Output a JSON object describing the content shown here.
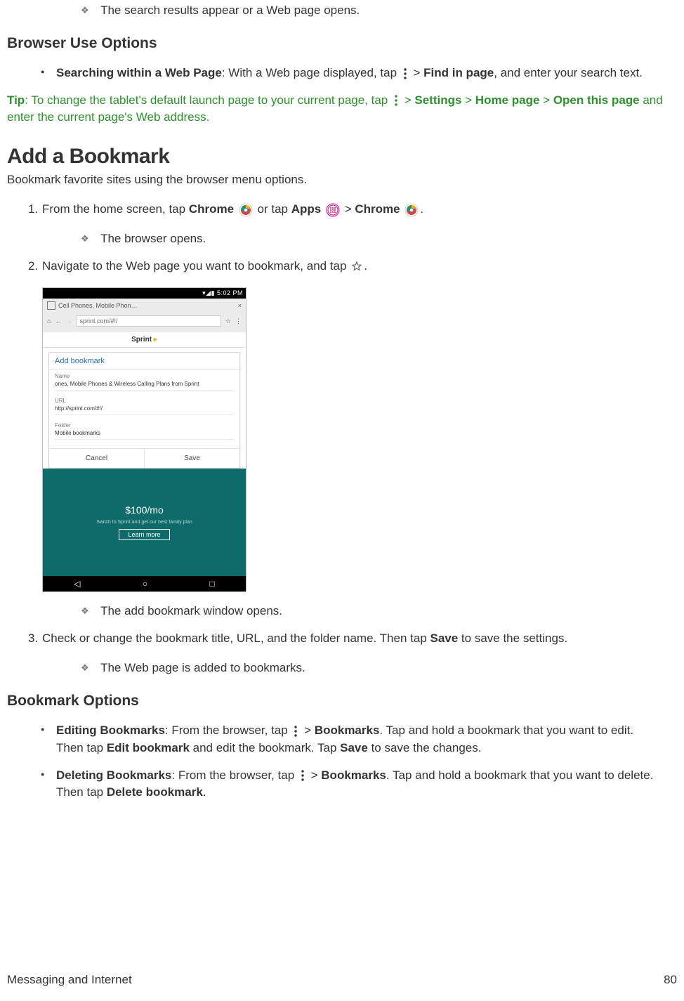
{
  "top_result": "The search results appear or a Web page opens.",
  "browser_use": {
    "heading": "Browser Use Options",
    "item_label": "Searching within a Web Page",
    "item_text": ": With a Web page displayed, tap ",
    "item_gt": " > ",
    "find_in_page": "Find in page",
    "item_tail": ", and enter your search text."
  },
  "tip": {
    "prefix": "Tip",
    "a": ": To change the tablet's default launch page to your current page, tap ",
    "gt1": " > ",
    "settings": "Settings",
    "gt2": " > ",
    "home_page": "Home page",
    "gt3": " > ",
    "open": "Open this page",
    "tail": " and enter the current page's Web address."
  },
  "add_bm": {
    "heading": "Add a Bookmark",
    "lead": "Bookmark favorite sites using the browser menu options.",
    "s1a": "From the home screen, tap ",
    "chrome": "Chrome",
    "s1b": " or tap ",
    "apps": "Apps",
    "s1gt": " > ",
    "s1tail": ".",
    "r1": "The browser opens.",
    "s2a": "Navigate to the Web page you want to bookmark, and tap ",
    "s2tail": ".",
    "r2": "The add bookmark window opens.",
    "s3a": "Check or change the bookmark title, URL, and the folder name. Then tap ",
    "save": "Save",
    "s3tail": " to save the settings.",
    "r3": "The Web page is added to bookmarks."
  },
  "bm_opts": {
    "heading": "Bookmark Options",
    "edit_label": "Editing Bookmarks",
    "edit_a": ": From the browser, tap ",
    "edit_gt": " > ",
    "bookmarks": "Bookmarks",
    "edit_b": ". Tap and hold a bookmark that you want to edit. Then tap ",
    "edit_bm": "Edit bookmark",
    "edit_c": " and edit the bookmark. Tap ",
    "save": "Save",
    "edit_d": " to save the changes.",
    "del_label": "Deleting Bookmarks",
    "del_a": ": From the browser, tap ",
    "del_gt": " > ",
    "del_b": ". Tap and hold a bookmark that you want to delete. Then tap ",
    "del_bm": "Delete bookmark",
    "del_tail": "."
  },
  "shot": {
    "status": "▾◢▮ 5:02 PM",
    "tab_text": "Cell Phones, Mobile Phon…",
    "url": "sprint.com/#!/",
    "sprint": "Sprint",
    "dlg_title": "Add bookmark",
    "name_lbl": "Name",
    "name_val": "ones, Mobile Phones & Wireless Calling Plans from Sprint",
    "url_lbl": "URL",
    "url_val": "http://sprint.com/#!/",
    "folder_lbl": "Folder",
    "folder_val": "Mobile bookmarks",
    "cancel": "Cancel",
    "save": "Save",
    "price": "$100/mo",
    "learn": "Learn more"
  },
  "footer_left": "Messaging and Internet",
  "footer_right": "80"
}
